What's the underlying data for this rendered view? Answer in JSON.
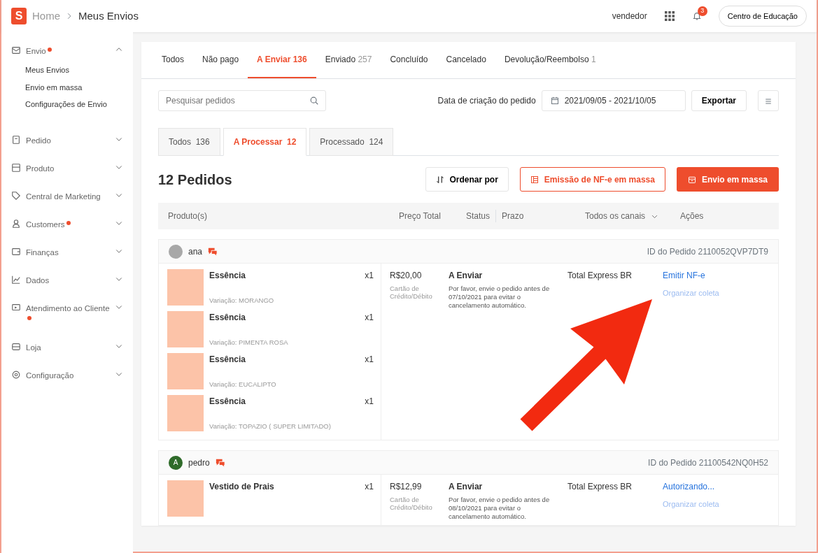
{
  "header": {
    "logo": "S",
    "breadcrumb": [
      "Home",
      "Meus Envios"
    ],
    "user": "vendedor",
    "notification_count": "3",
    "education_button": "Centro de Educação"
  },
  "sidebar": {
    "items": [
      {
        "label": "Envio",
        "dot": true,
        "expanded": true,
        "children": [
          {
            "label": "Meus Envios"
          },
          {
            "label": "Envio em massa"
          },
          {
            "label": "Configurações de Envio"
          }
        ]
      },
      {
        "label": "Pedido",
        "dot": false,
        "expanded": false
      },
      {
        "label": "Produto",
        "dot": false,
        "expanded": false
      },
      {
        "label": "Central de Marketing",
        "dot": false,
        "expanded": false
      },
      {
        "label": "Customers",
        "dot": true,
        "expanded": false
      },
      {
        "label": "Finanças",
        "dot": false,
        "expanded": false
      },
      {
        "label": "Dados",
        "dot": false,
        "expanded": false
      },
      {
        "label": "Atendimento ao Cliente",
        "dot": true,
        "expanded": false
      },
      {
        "label": "Loja",
        "dot": false,
        "expanded": false
      },
      {
        "label": "Configuração",
        "dot": false,
        "expanded": false
      }
    ]
  },
  "tabs": [
    {
      "label": "Todos",
      "selected": false
    },
    {
      "label": "Não pago",
      "selected": false
    },
    {
      "label": "A Enviar",
      "count": "136",
      "selected": true
    },
    {
      "label": "Enviado",
      "count": "257",
      "selected": false
    },
    {
      "label": "Concluído",
      "selected": false
    },
    {
      "label": "Cancelado",
      "selected": false
    },
    {
      "label": "Devolução/Reembolso",
      "count": "1",
      "selected": false
    }
  ],
  "filters": {
    "search": {
      "placeholder": "Pesquisar pedidos"
    },
    "date_label": "Data de criação do pedido",
    "date_range": "2021/09/05 - 2021/10/05",
    "export_button": "Exportar"
  },
  "subtabs": [
    {
      "label": "Todos",
      "count": "136",
      "selected": false
    },
    {
      "label": "A Processar",
      "count": "12",
      "selected": true
    },
    {
      "label": "Processado",
      "count": "124",
      "selected": false
    }
  ],
  "orders_title": "12 Pedidos",
  "actions": {
    "sort_button": "Ordenar por",
    "nfe_button": "Emissão de NF-e em massa",
    "mass_ship_button": "Envio em massa"
  },
  "table": {
    "columns": [
      "Produto(s)",
      "Preço Total",
      "Status",
      "Prazo",
      "Todos os canais",
      "Ações"
    ]
  },
  "orders": [
    {
      "buyer": "ana",
      "avatar": {
        "color": "#a8a8a8"
      },
      "order_id": "ID do Pedido 2110052QVP7DT9",
      "products": [
        {
          "name": "Essência",
          "variation": "Variação: MORANGO",
          "qty": "x1"
        },
        {
          "name": "Essência",
          "variation": "Variação: PIMENTA ROSA",
          "qty": "x1"
        },
        {
          "name": "Essência",
          "variation": "Variação: EUCALIPTO",
          "qty": "x1"
        },
        {
          "name": "Essência",
          "variation": "Variação: TOPAZIO ( SUPER LIMITADO)",
          "qty": "x1"
        }
      ],
      "price": "R$20,00",
      "payment": "Cartão de Crédito/Débito",
      "status": "A Enviar",
      "status_note": "Por favor, envie o pedido antes de 07/10/2021 para evitar o cancelamento automático.",
      "carrier": "Total Express BR",
      "order_actions": [
        {
          "label": "Emitir NF-e",
          "kind": "primary"
        },
        {
          "label": "Organizar coleta",
          "kind": "secondary"
        }
      ]
    },
    {
      "buyer": "pedro",
      "avatar": {
        "color": "#2f6b2a",
        "letter": "A"
      },
      "order_id": "ID do Pedido 21100542NQ0H52",
      "products": [
        {
          "name": "Vestido de Prais",
          "qty": "x1"
        }
      ],
      "price": "R$12,99",
      "payment": "Cartão de Crédito/Débito",
      "status": "A Enviar",
      "status_note": "Por favor, envie o pedido antes de 08/10/2021 para evitar o cancelamento automático.",
      "carrier": "Total Express BR",
      "order_actions": [
        {
          "label": "Autorizando...",
          "kind": "primary"
        },
        {
          "label": "Organizar coleta",
          "kind": "secondary"
        }
      ]
    }
  ]
}
